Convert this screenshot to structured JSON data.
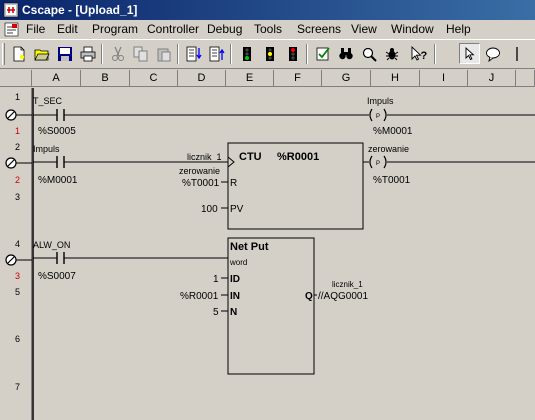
{
  "window": {
    "title": "Cscape - [Upload_1]"
  },
  "menu": [
    "File",
    "Edit",
    "Program",
    "Controller",
    "Debug",
    "Tools",
    "Screens",
    "View",
    "Window",
    "Help"
  ],
  "toolbar": [
    "new-icon",
    "open-icon",
    "save-icon",
    "print-icon",
    "cut-icon",
    "copy-icon",
    "paste-icon",
    "sort-down-icon",
    "sort-up-icon",
    "signal-green-icon",
    "signal-yellow-icon",
    "signal-red-icon",
    "verify-icon",
    "binoculars-icon",
    "magnify-icon",
    "bug-icon",
    "help-pointer-icon",
    "select-arrow-icon",
    "comment-icon",
    "vertical-line-icon"
  ],
  "columns": [
    "A",
    "B",
    "C",
    "D",
    "E",
    "F",
    "G",
    "H",
    "I",
    "J"
  ],
  "rungs": [
    {
      "num": "1",
      "sub": "1",
      "line": "1",
      "circle": true
    },
    {
      "num": "2",
      "sub": "2",
      "line": "2",
      "circle": true
    },
    {
      "num": "3",
      "line": "3"
    },
    {
      "num": "4",
      "sub": "3",
      "line": "4",
      "circle": true
    },
    {
      "num": "5",
      "line": "5"
    },
    {
      "num": "6",
      "line": "6"
    },
    {
      "num": "7",
      "line": "7"
    }
  ],
  "rung1": {
    "contact_name": "T_SEC",
    "contact_addr": "%S0005",
    "coil_name": "Impuls",
    "coil_addr": "%M0001",
    "coil_glyph": "P"
  },
  "rung2": {
    "contact_name": "Impuls",
    "contact_addr": "%M0001",
    "ctu": {
      "title": "CTU",
      "ref": "%R0001",
      "in_label": "licznik_1",
      "r_label": "zerowanie",
      "r_addr": "%T0001",
      "r_pin": "R",
      "pv_value": "100",
      "pv_pin": "PV"
    },
    "coil_name": "zerowanie",
    "coil_addr": "%T0001",
    "coil_glyph": "P"
  },
  "rung4": {
    "contact_name": "ALW_ON",
    "contact_addr": "%S0007",
    "netput": {
      "title": "Net Put",
      "subtitle": "word",
      "id_value": "1",
      "id_pin": "ID",
      "in_value": "%R0001",
      "in_pin": "IN",
      "n_value": "5",
      "n_pin": "N",
      "q_pin": "Q",
      "q_name": "licznik_1",
      "q_addr": "//AQG0001"
    }
  }
}
